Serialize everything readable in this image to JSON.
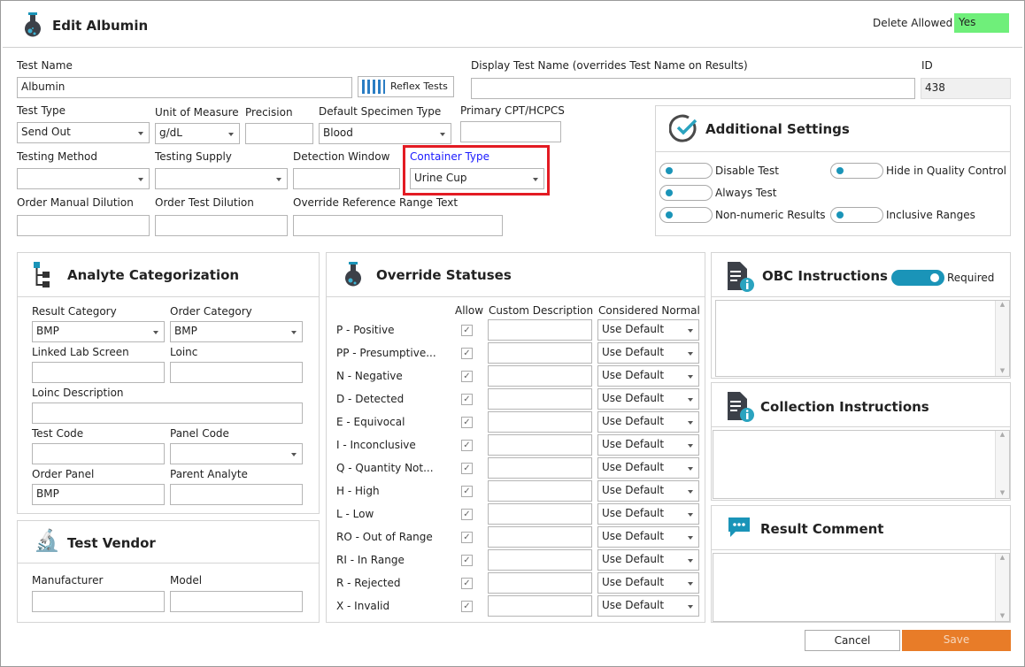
{
  "title": "Edit Albumin",
  "delete_allowed": {
    "label": "Delete Allowed",
    "value": "Yes",
    "color": "#6fef7a"
  },
  "fields": {
    "test_name": {
      "label": "Test Name",
      "value": "Albumin"
    },
    "reflex_tests": "Reflex Tests",
    "display_test_name": {
      "label": "Display Test Name (overrides Test Name on Results)",
      "value": ""
    },
    "id": {
      "label": "ID",
      "value": "438"
    },
    "test_type": {
      "label": "Test Type",
      "value": "Send Out"
    },
    "unit_of_measure": {
      "label": "Unit of Measure",
      "value": "g/dL"
    },
    "precision": {
      "label": "Precision",
      "value": ""
    },
    "default_specimen_type": {
      "label": "Default Specimen Type",
      "value": "Blood"
    },
    "primary_cpt": {
      "label": "Primary CPT/HCPCS",
      "value": ""
    },
    "testing_method": {
      "label": "Testing Method",
      "value": ""
    },
    "testing_supply": {
      "label": "Testing Supply",
      "value": ""
    },
    "detection_window": {
      "label": "Detection Window",
      "value": ""
    },
    "container_type": {
      "label": "Container Type",
      "value": "Urine Cup",
      "highlight": "#e31b23",
      "label_color": "#1a1aff"
    },
    "order_manual_dilution": {
      "label": "Order Manual Dilution",
      "value": ""
    },
    "order_test_dilution": {
      "label": "Order Test Dilution",
      "value": ""
    },
    "override_reference_range_text": {
      "label": "Override Reference Range Text",
      "value": ""
    }
  },
  "additional_settings": {
    "title": "Additional Settings",
    "toggles": [
      {
        "label": "Disable Test",
        "on": false
      },
      {
        "label": "Hide in Quality Control",
        "on": false
      },
      {
        "label": "Always Test",
        "on": false
      },
      {
        "label": "Non-numeric Results",
        "on": false
      },
      {
        "label": "Inclusive Ranges",
        "on": false
      }
    ]
  },
  "analyte": {
    "title": "Analyte Categorization",
    "result_category": {
      "label": "Result Category",
      "value": "BMP"
    },
    "order_category": {
      "label": "Order Category",
      "value": "BMP"
    },
    "linked_lab_screen": {
      "label": "Linked Lab Screen",
      "value": ""
    },
    "loinc": {
      "label": "Loinc",
      "value": ""
    },
    "loinc_description": {
      "label": "Loinc Description",
      "value": ""
    },
    "test_code": {
      "label": "Test Code",
      "value": ""
    },
    "panel_code": {
      "label": "Panel Code",
      "value": ""
    },
    "order_panel": {
      "label": "Order Panel",
      "value": "BMP"
    },
    "parent_analyte": {
      "label": "Parent Analyte",
      "value": ""
    }
  },
  "vendor": {
    "title": "Test Vendor",
    "manufacturer": {
      "label": "Manufacturer",
      "value": ""
    },
    "model": {
      "label": "Model",
      "value": ""
    }
  },
  "override": {
    "title": "Override Statuses",
    "col_allow": "Allow",
    "col_desc": "Custom Description",
    "col_normal": "Considered Normal",
    "rows": [
      {
        "status": "P - Positive",
        "allow": true,
        "normal": "Use Default"
      },
      {
        "status": "PP - Presumptive...",
        "allow": true,
        "normal": "Use Default"
      },
      {
        "status": "N - Negative",
        "allow": true,
        "normal": "Use Default"
      },
      {
        "status": "D - Detected",
        "allow": true,
        "normal": "Use Default"
      },
      {
        "status": "E - Equivocal",
        "allow": true,
        "normal": "Use Default"
      },
      {
        "status": "I - Inconclusive",
        "allow": true,
        "normal": "Use Default"
      },
      {
        "status": "Q - Quantity Not...",
        "allow": true,
        "normal": "Use Default"
      },
      {
        "status": "H - High",
        "allow": true,
        "normal": "Use Default"
      },
      {
        "status": "L - Low",
        "allow": true,
        "normal": "Use Default"
      },
      {
        "status": "RO - Out of Range",
        "allow": true,
        "normal": "Use Default"
      },
      {
        "status": "RI - In Range",
        "allow": true,
        "normal": "Use Default"
      },
      {
        "status": "R - Rejected",
        "allow": true,
        "normal": "Use Default"
      },
      {
        "status": "X - Invalid",
        "allow": true,
        "normal": "Use Default"
      }
    ]
  },
  "obc": {
    "title": "OBC Instructions",
    "required_label": "Required",
    "required": true
  },
  "collection": {
    "title": "Collection Instructions"
  },
  "result_comment": {
    "title": "Result Comment"
  },
  "buttons": {
    "cancel": "Cancel",
    "save": "Save",
    "save_color": "#e87c28"
  },
  "accent": "#1a94b8"
}
